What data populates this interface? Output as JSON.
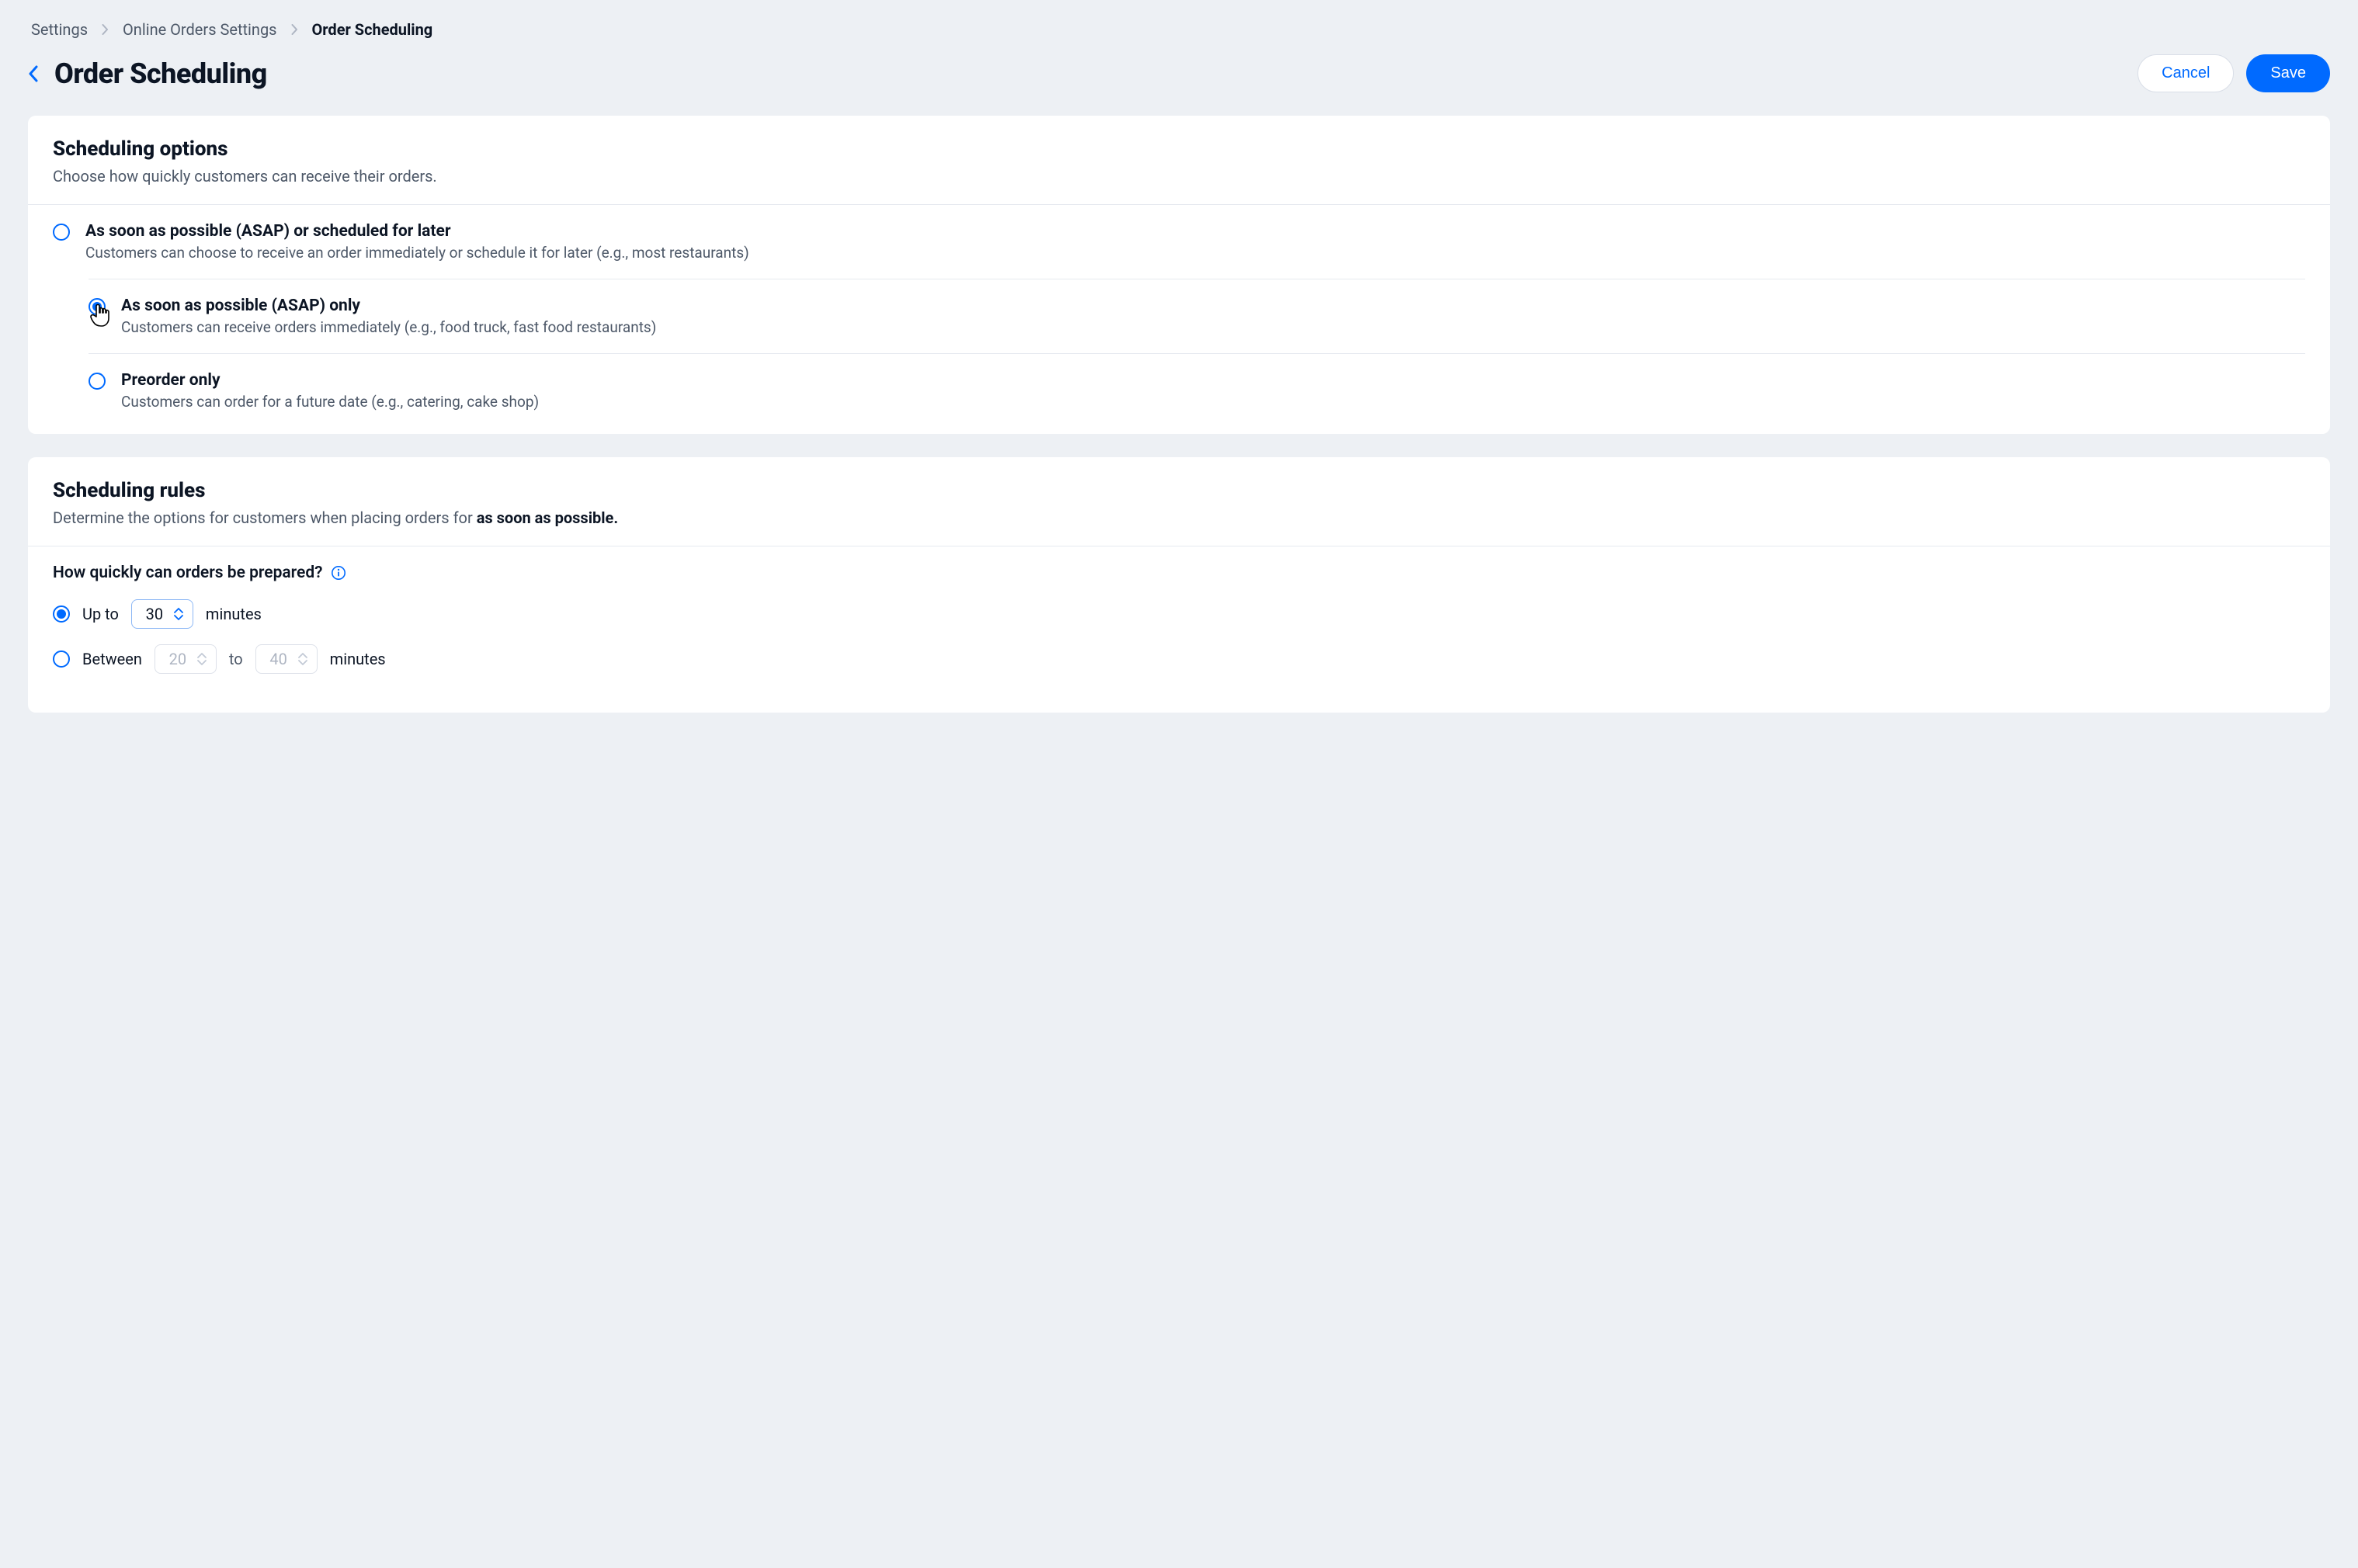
{
  "breadcrumbs": {
    "items": [
      "Settings",
      "Online Orders Settings",
      "Order Scheduling"
    ]
  },
  "header": {
    "title": "Order Scheduling",
    "cancel_label": "Cancel",
    "save_label": "Save"
  },
  "scheduling_options": {
    "title": "Scheduling options",
    "subtitle": "Choose how quickly customers can receive their orders.",
    "options": [
      {
        "title": "As soon as possible (ASAP) or scheduled for later",
        "desc": "Customers can choose to receive an order immediately or schedule it for later (e.g., most restaurants)",
        "selected": false
      },
      {
        "title": "As soon as possible (ASAP)  only",
        "desc": "Customers can receive orders immediately (e.g., food truck, fast food restaurants)",
        "selected": true
      },
      {
        "title": "Preorder only",
        "desc": "Customers can order for a future date (e.g., catering, cake shop)",
        "selected": false
      }
    ]
  },
  "scheduling_rules": {
    "title": "Scheduling rules",
    "subtitle_prefix": "Determine the options for customers when placing orders for ",
    "subtitle_strong": "as soon as possible.",
    "question": "How quickly can orders be prepared?",
    "prep_options": {
      "upto": {
        "label_before": "Up to",
        "value": "30",
        "label_after": "minutes",
        "selected": true
      },
      "between": {
        "label_before": "Between",
        "value_from": "20",
        "label_to": "to",
        "value_to": "40",
        "label_after": "minutes",
        "selected": false
      }
    }
  }
}
